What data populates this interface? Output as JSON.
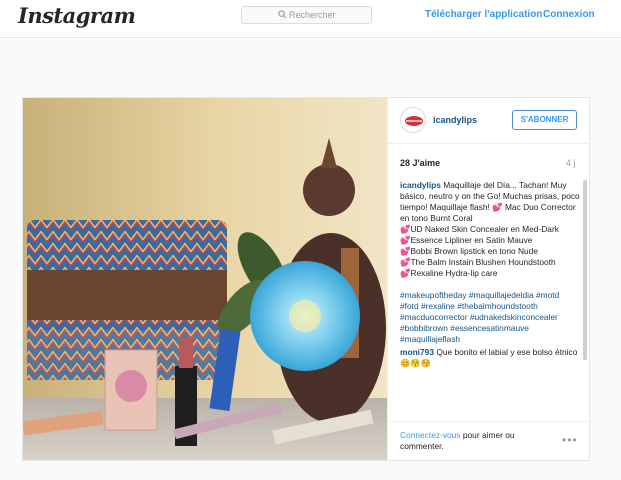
{
  "app": {
    "logo": "Instagram"
  },
  "search": {
    "placeholder": "Rechercher"
  },
  "nav": {
    "app_link": "Télécharger l'application",
    "login_link": "Connexion"
  },
  "post": {
    "username": "icandylips",
    "follow_label": "S'ABONNER",
    "likes": "28 J'aime",
    "age": "4 j",
    "caption": {
      "author": "icandylips",
      "intro": "Maquillaje del Día... Tachan! Muy básico, neutro y on the Go! Muchas prisas, poco tiempo! Maquillaje flash!",
      "items": [
        "Mac Duo Corrector en tono Burnt Coral",
        "UD Naked Skin Concealer en Med-Dark",
        "Essence Lipliner en Satin Mauve",
        "Bobbi Brown lipstick en tono Nude",
        "The Balm Instain Blushen Houndstooth",
        "Rexaline Hydra-lip care"
      ],
      "hashtags": "#makeupoftheday #maquillajedeldia #motd #fotd #rexaline #thebalmhoundstooth #macduocorrector #udnakedskinconcealer #bobbibrown #essencesatinmauve #maquillajeflash"
    },
    "comment": {
      "author": "moni793",
      "text": "Que bonito el labial y ese bolso étnico😊😚😚"
    },
    "footer": {
      "login_link": "Connectez-vous",
      "login_rest": "pour aimer ou commenter.",
      "more": "•••"
    }
  },
  "colors": {
    "link": "#3897f0",
    "username": "#125688",
    "accent_heart": "#f06fb0"
  }
}
